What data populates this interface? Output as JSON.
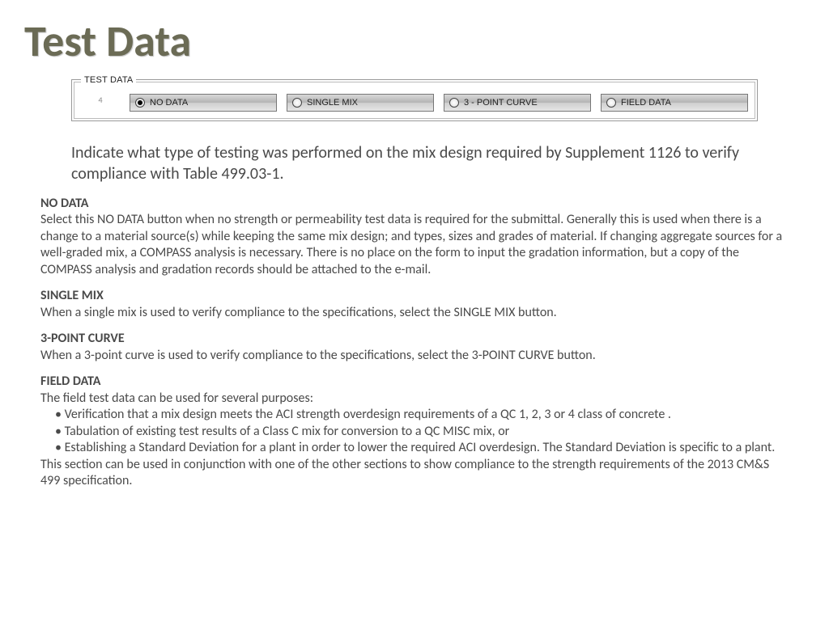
{
  "title": "Test Data",
  "fieldset": {
    "legend": "TEST DATA",
    "tiny": "4",
    "options": [
      "NO DATA",
      "SINGLE MIX",
      "3 - POINT CURVE",
      "FIELD DATA"
    ],
    "selected": 0
  },
  "intro": "Indicate what type of testing was performed on the mix design required by Supplement 1126 to verify compliance with Table 499.03-1.",
  "sections": {
    "nodata": {
      "h": "NO DATA",
      "p": "Select this NO DATA button when no strength or permeability test data is required for the submittal.  Generally this is used when there is a change to a material source(s) while keeping the same mix design; and types, sizes and grades of material.  If changing aggregate sources for a well-graded mix, a COMPASS analysis is necessary.  There is no place on the form to input the gradation information, but a copy of the COMPASS analysis and gradation records should be attached to the e-mail."
    },
    "singlemix": {
      "h": "SINGLE MIX",
      "p": "When a single mix is used to verify compliance to the specifications, select the SINGLE MIX button."
    },
    "threepoint": {
      "h": "3-POINT CURVE",
      "p": "When a 3-point curve is used to verify compliance to the specifications, select the 3-POINT CURVE button."
    },
    "fielddata": {
      "h": "FIELD DATA",
      "p1": "The field test data can be used for several purposes:",
      "b1": "Verification that a mix design meets the ACI strength overdesign requirements of a QC 1, 2, 3 or 4 class of concrete .",
      "b2": "Tabulation of existing test results of a Class C mix for conversion to a QC MISC mix, or",
      "b3": "Establishing a Standard Deviation for a plant in order to lower the required ACI overdesign.  The Standard Deviation is specific to a plant.",
      "p2": "This section can be used in conjunction with one of the other sections to show compliance to the strength requirements of the 2013 CM&S 499 specification."
    }
  }
}
